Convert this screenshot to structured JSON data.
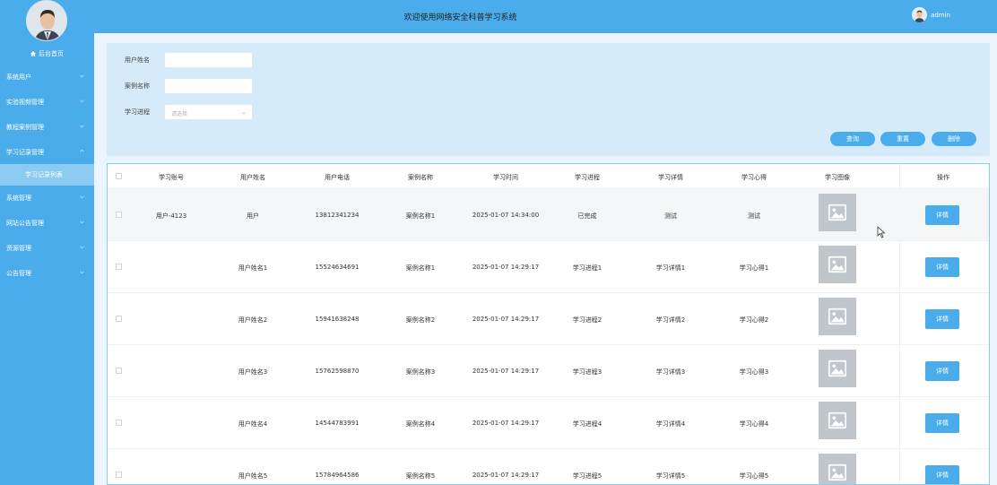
{
  "header": {
    "title": "欢迎使用网络安全科普学习系统",
    "username": "admin"
  },
  "sidebar": {
    "home": "后台首页",
    "items": [
      {
        "label": "系统用户",
        "expanded": false
      },
      {
        "label": "实验视频管理",
        "expanded": false
      },
      {
        "label": "教程案例管理",
        "expanded": false
      },
      {
        "label": "学习记录管理",
        "expanded": true
      },
      {
        "label": "系统管理",
        "expanded": false
      },
      {
        "label": "网站公告管理",
        "expanded": false
      },
      {
        "label": "资源管理",
        "expanded": false
      },
      {
        "label": "公告管理",
        "expanded": false
      }
    ],
    "subitem": "学习记录列表"
  },
  "search": {
    "username_label": "用户姓名",
    "case_label": "案例名称",
    "progress_label": "学习进程",
    "progress_placeholder": "请选择",
    "query_btn": "查询",
    "reset_btn": "重置",
    "delete_btn": "删除"
  },
  "table": {
    "columns": [
      "学习账号",
      "用户姓名",
      "用户电话",
      "案例名称",
      "学习时间",
      "学习进程",
      "学习详情",
      "学习心得",
      "学习图像",
      "操作"
    ],
    "detail_label": "详情",
    "rows": [
      {
        "account": "用户-4123",
        "name": "用户",
        "phone": "13812341234",
        "case": "案例名称1",
        "time": "2025-01-07 14:34:00",
        "progress": "已完成",
        "detail": "测试",
        "note": "测试"
      },
      {
        "account": "",
        "name": "用户姓名1",
        "phone": "15524634691",
        "case": "案例名称1",
        "time": "2025-01-07 14:29:17",
        "progress": "学习进程1",
        "detail": "学习详情1",
        "note": "学习心得1"
      },
      {
        "account": "",
        "name": "用户姓名2",
        "phone": "15941638248",
        "case": "案例名称2",
        "time": "2025-01-07 14:29:17",
        "progress": "学习进程2",
        "detail": "学习详情2",
        "note": "学习心得2"
      },
      {
        "account": "",
        "name": "用户姓名3",
        "phone": "15762598870",
        "case": "案例名称3",
        "time": "2025-01-07 14:29:17",
        "progress": "学习进程3",
        "detail": "学习详情3",
        "note": "学习心得3"
      },
      {
        "account": "",
        "name": "用户姓名4",
        "phone": "14544783991",
        "case": "案例名称4",
        "time": "2025-01-07 14:29:17",
        "progress": "学习进程4",
        "detail": "学习详情4",
        "note": "学习心得4"
      },
      {
        "account": "",
        "name": "用户姓名5",
        "phone": "15784964586",
        "case": "案例名称5",
        "time": "2025-01-07 14:29:17",
        "progress": "学习进程5",
        "detail": "学习详情5",
        "note": "学习心得5"
      }
    ]
  },
  "colors": {
    "primary": "#4aaceb",
    "panel": "#d5ebf9",
    "page_bg": "#eaf5fd",
    "submenu": "#8ccaf2",
    "image_placeholder": "#c1c5cc"
  }
}
